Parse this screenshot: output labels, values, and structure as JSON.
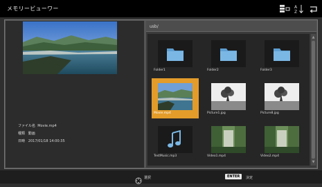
{
  "header": {
    "title": "メモリービューワー",
    "icons": [
      "view-toggle-icon",
      "sort-icon",
      "return-icon"
    ]
  },
  "preview": {
    "file_name_label": "ファイル名",
    "file_name": "Movie.mp4",
    "info_label": "種類",
    "info_value": "動画",
    "date_label": "日時",
    "date_value": "2017/01/18  14:00:35"
  },
  "browser": {
    "path": "usb/",
    "items": [
      {
        "label": "Folder1",
        "type": "folder"
      },
      {
        "label": "Folder2",
        "type": "folder"
      },
      {
        "label": "Folder3",
        "type": "folder"
      },
      {
        "label": "Movie.mp4",
        "type": "video-landscape"
      },
      {
        "label": "Picture1.jpg",
        "type": "photo-tree"
      },
      {
        "label": "Picture8.jpg",
        "type": "photo-tree"
      },
      {
        "label": "TestMusic.mp3",
        "type": "music"
      },
      {
        "label": "Video1.mp4",
        "type": "video-forest"
      },
      {
        "label": "Video2.mp4",
        "type": "video-forest"
      }
    ],
    "selected_index": 3
  },
  "footer": {
    "nav_label": "選択",
    "enter_key": "ENTER",
    "enter_label": "決定"
  },
  "colors": {
    "selected": "#e39c2a",
    "folder": "#6aa9d8"
  }
}
